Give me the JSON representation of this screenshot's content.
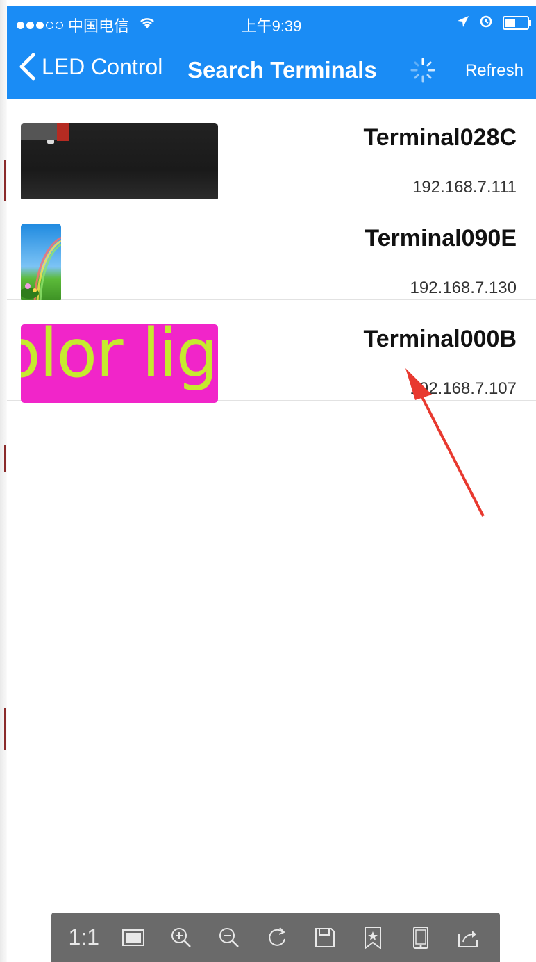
{
  "status_bar": {
    "carrier": "中国电信",
    "time": "上午9:39"
  },
  "nav": {
    "back_label": "LED Control",
    "title": "Search Terminals",
    "refresh_label": "Refresh"
  },
  "terminals": [
    {
      "name": "Terminal028C",
      "ip": "192.168.7.111"
    },
    {
      "name": "Terminal090E",
      "ip": "192.168.7.130"
    },
    {
      "name": "Terminal000B",
      "ip": "192.168.7.107",
      "thumbnail_text": "olor lig"
    }
  ],
  "toolbar": {
    "actual_size_label": "1:1",
    "icons": [
      "fit-screen-icon",
      "zoom-in-icon",
      "zoom-out-icon",
      "rotate-icon",
      "save-icon",
      "bookmark-icon",
      "device-icon",
      "share-icon"
    ]
  },
  "colors": {
    "nav_blue": "#1a8cf5",
    "arrow_red": "#e8392f",
    "thumbnail_magenta": "#f125c9",
    "thumbnail_text": "#c6ea2f"
  }
}
